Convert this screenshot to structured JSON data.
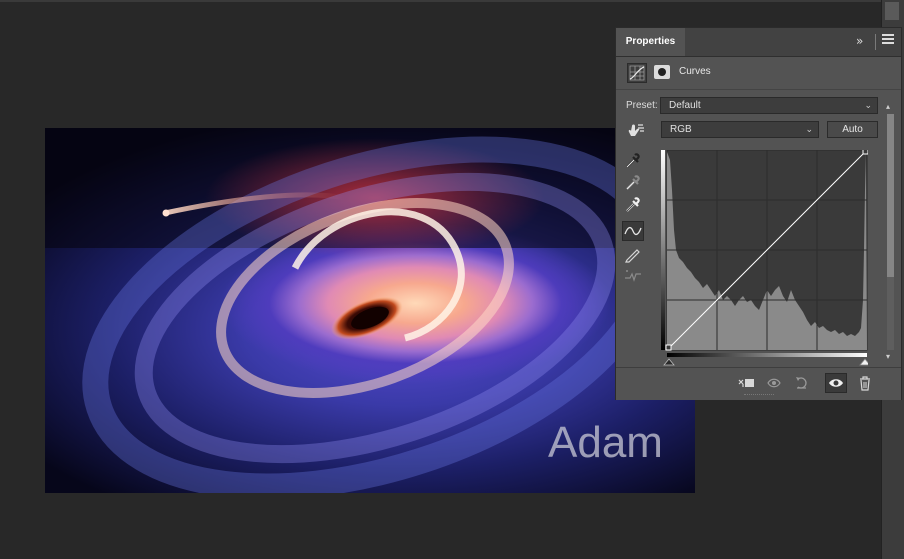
{
  "image": {
    "watermark_text": "Adam"
  },
  "properties_panel": {
    "tab_label": "Properties",
    "collapse_glyph": "»",
    "adjustment_title": "Curves",
    "preset_label": "Preset:",
    "preset_value": "Default",
    "channel_value": "RGB",
    "auto_button": "Auto",
    "icons": {
      "adjustment": "curves-adjustment-icon",
      "mask": "layer-mask-icon",
      "on_image": "on-image-adjustment-icon",
      "eyedroppers": [
        "black-point-eyedropper-icon",
        "gray-point-eyedropper-icon",
        "white-point-eyedropper-icon"
      ],
      "curve_tool": "curve-points-icon",
      "pencil": "pencil-icon",
      "smooth": "smooth-curve-icon",
      "footer": [
        "clip-to-layer-icon",
        "view-previous-state-icon",
        "reset-icon",
        "visibility-eye-icon",
        "trash-icon"
      ]
    },
    "colors": {
      "panel_bg": "#535353",
      "graph_bg": "#3a3a3a",
      "histogram": "#8a8a8a"
    }
  }
}
